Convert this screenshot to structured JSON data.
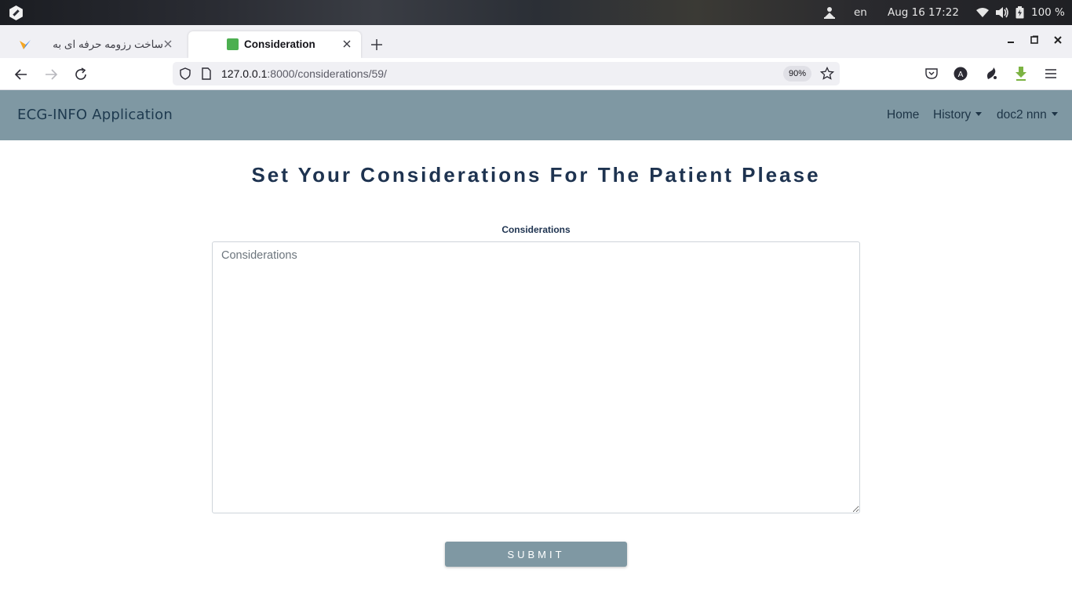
{
  "os": {
    "language": "en",
    "date": "Aug 16",
    "time": "17:22",
    "battery": "100 %"
  },
  "browser": {
    "tabs": [
      {
        "label": "ساخت رزومه حرفه ای به",
        "active": false,
        "favicon": "resume-site-icon"
      },
      {
        "label": "Consideration",
        "active": true,
        "favicon": "green-square-icon"
      }
    ],
    "url": {
      "host": "127.0.0.1",
      "path": ":8000/considerations/59/"
    },
    "zoom": "90%"
  },
  "app": {
    "brand": "ECG-INFO Application",
    "nav": {
      "home": "Home",
      "history": "History",
      "user": "doc2 nnn"
    }
  },
  "main": {
    "title": "Set Your Considerations For The Patient Please",
    "field_label": "Considerations",
    "textarea_placeholder": "Considerations",
    "textarea_value": "",
    "submit_label": "SUBMIT"
  },
  "colors": {
    "header_bg": "#7f98a3",
    "title_text": "#1e3350",
    "button_bg": "#7f98a3"
  }
}
